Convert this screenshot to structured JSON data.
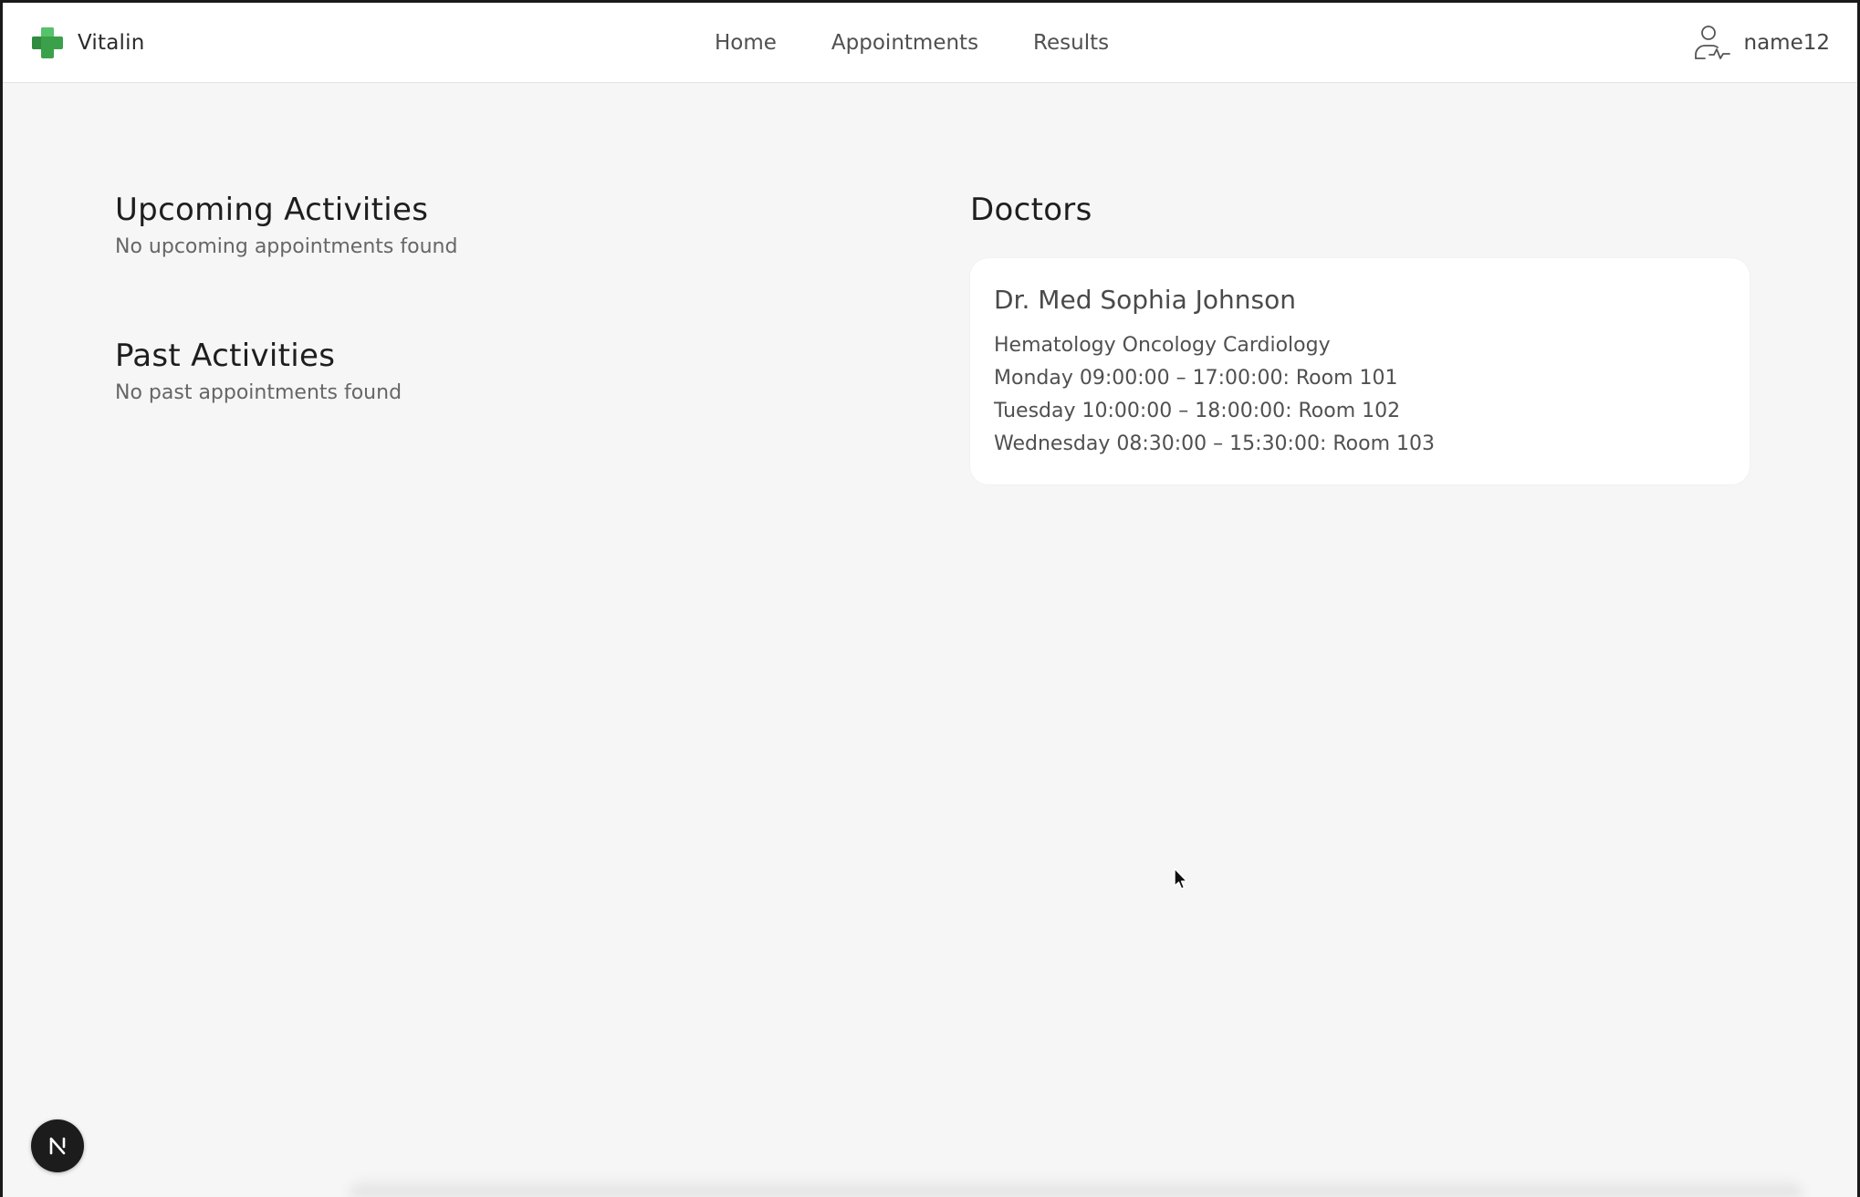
{
  "header": {
    "brand": {
      "name": "Vitalin",
      "logo_icon": "medical-cross-icon",
      "accent": "#3aa14a"
    },
    "nav": [
      {
        "label": "Home"
      },
      {
        "label": "Appointments"
      },
      {
        "label": "Results"
      }
    ],
    "user": {
      "name": "name12",
      "icon": "user-health-icon"
    }
  },
  "upcoming": {
    "title": "Upcoming Activities",
    "empty_text": "No upcoming appointments found"
  },
  "past": {
    "title": "Past Activities",
    "empty_text": "No past appointments found"
  },
  "doctors": {
    "title": "Doctors",
    "items": [
      {
        "name": "Dr. Med Sophia Johnson",
        "specialties": "Hematology Oncology Cardiology",
        "schedule": [
          "Monday 09:00:00 – 17:00:00: Room 101",
          "Tuesday 10:00:00 – 18:00:00: Room 102",
          "Wednesday 08:30:00 – 15:30:00: Room 103"
        ]
      }
    ]
  },
  "badge": {
    "letter_icon": "n-logo-icon"
  }
}
